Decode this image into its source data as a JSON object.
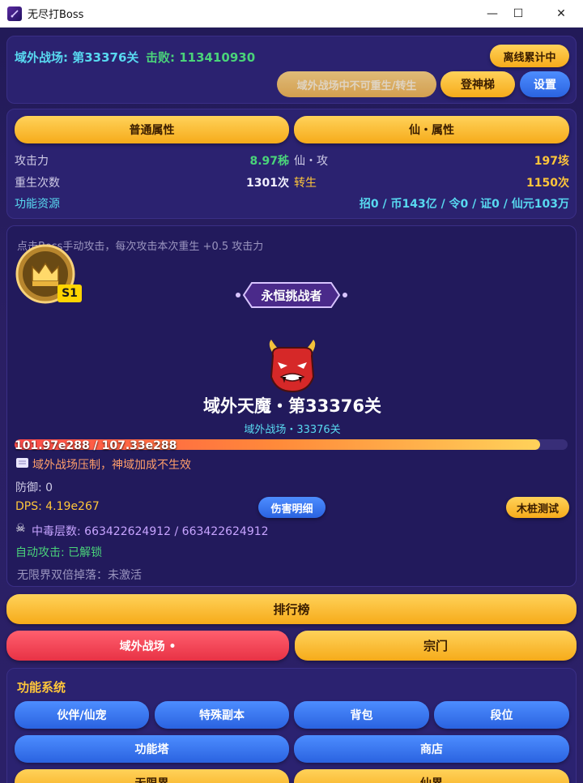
{
  "window": {
    "title": "无尽打Boss",
    "minimize": "—",
    "maximize": "☐",
    "close": "✕"
  },
  "header": {
    "stage_label": "域外战场: 第33376关",
    "defeat_label": "击败: 113410930",
    "offline_button": "离线累计中",
    "rebirth_disabled_button": "域外战场中不可重生/转生",
    "ladder_button": "登神梯",
    "settings_button": "设置"
  },
  "attributes": {
    "tab_normal": "普通属性",
    "tab_immortal": "仙・属性",
    "attack_label": "攻击力",
    "attack_value": "8.97秭",
    "immortal_attack_label": "仙・攻",
    "immortal_attack_value": "197垓",
    "rebirth_label": "重生次数",
    "rebirth_value": "1301次",
    "transmigrate_label": "转生",
    "transmigrate_value": "1150次",
    "resources_label": "功能资源",
    "resources_value": "招0 / 币143亿 / 令0 / 证0 / 仙元103万"
  },
  "battle": {
    "hint": "点击Boss手动攻击，每次攻击本次重生 +0.5 攻击力",
    "rank_badge": "S1",
    "challenger_title": "永恒挑战者",
    "boss_name": "域外天魔・第33376关",
    "boss_sub": "域外战场・33376关",
    "hp_text": "101.97e288 / 107.33e288",
    "hp_fraction": 0.95,
    "suppression_text": "域外战场压制，神域加成不生效",
    "defense_text": "防御: 0",
    "dps_text": "DPS: 4.19e267",
    "damage_detail_button": "伤害明细",
    "dummy_test_button": "木桩测试",
    "poison_text": "中毒层数: 663422624912 / 663422624912",
    "auto_attack_text": "自动攻击: 已解锁",
    "double_drop_text": "无限界双倍掉落：未激活"
  },
  "nav": {
    "leaderboard": "排行榜",
    "battlefield": "域外战场 •",
    "sect": "宗门"
  },
  "functions": {
    "title": "功能系统",
    "buttons": [
      "伙伴/仙宠",
      "特殊副本",
      "背包",
      "段位",
      "功能塔",
      "商店",
      "无限界",
      "仙界"
    ]
  },
  "colors": {
    "accent_gold": "#ffc63a",
    "accent_blue": "#2a63e0",
    "hp_red": "#ff4a4a",
    "hp_yellow": "#ffd25a"
  },
  "icons": {
    "app": "sword-icon",
    "crown": "crown-icon",
    "boss": "oni-mask-icon",
    "scroll": "scroll-icon",
    "poison": "skull-crossbones-icon"
  }
}
